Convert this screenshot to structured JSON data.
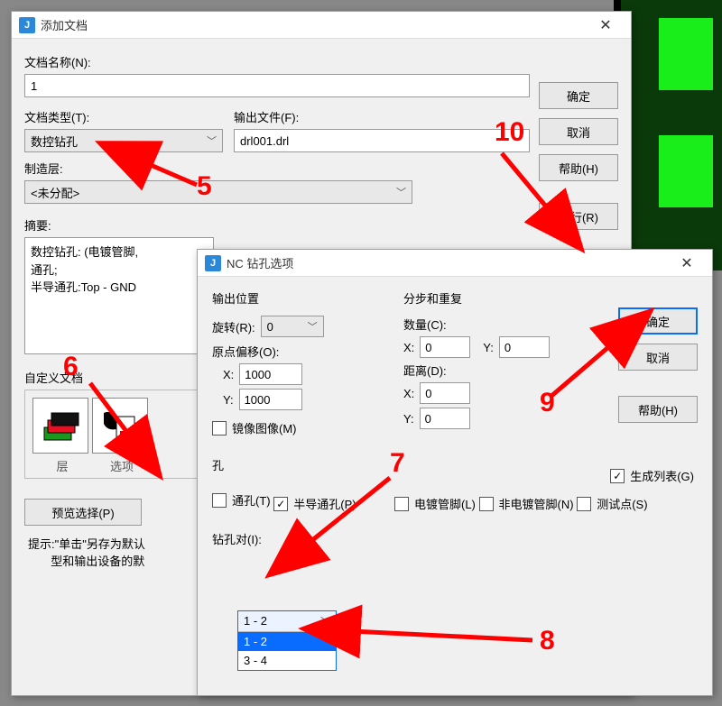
{
  "bg": {
    "ref": "1N0037"
  },
  "dialog1": {
    "title": "添加文档",
    "nameLabel": "文档名称(N):",
    "nameValue": "1",
    "typeLabel": "文档类型(T):",
    "typeValue": "数控钻孔",
    "outputLabel": "输出文件(F):",
    "outputValue": "drl001.drl",
    "layerLabel": "制造层:",
    "layerValue": "<未分配>",
    "summaryLabel": "摘要:",
    "summaryLine1": "数控钻孔: (电镀管脚,",
    "summaryLine2": "通孔;",
    "summaryLine3": "半导通孔:Top - GND",
    "customLabel": "自定义文档",
    "layersCaption": "层",
    "optionsCaption": "选项",
    "previewBtn": "预览选择(P)",
    "ok": "确定",
    "cancel": "取消",
    "help": "帮助(H)",
    "run": "运行(R)",
    "hint1": "提示:\"单击\"另存为默认",
    "hint2": "型和输出设备的默"
  },
  "dialog2": {
    "title": "NC 钻孔选项",
    "outputPosGroup": "输出位置",
    "rotateLabel": "旋转(R):",
    "rotateValue": "0",
    "originLabel": "原点偏移(O):",
    "x": "X:",
    "y": "Y:",
    "originX": "1000",
    "originY": "1000",
    "mirror": "镜像图像(M)",
    "stepGroup": "分步和重复",
    "countLabel": "数量(C):",
    "countX": "0",
    "countY": "0",
    "distLabel": "距离(D):",
    "distX": "0",
    "distY": "0",
    "holesGroup": "孔",
    "through": "通孔(T)",
    "partial": "半导通孔(P)",
    "plated": "电镀管脚(L)",
    "unplated": "非电镀管脚(N)",
    "testpoint": "测试点(S)",
    "drillPairLabel": "钻孔对(I):",
    "drillPairSel": "1 - 2",
    "drillPairOpt1": "1 - 2",
    "drillPairOpt2": "3 - 4",
    "genList": "生成列表(G)",
    "ok": "确定",
    "cancel": "取消",
    "help": "帮助(H)"
  },
  "annotations": {
    "n5": "5",
    "n6": "6",
    "n7": "7",
    "n8": "8",
    "n9": "9",
    "n10": "10"
  }
}
